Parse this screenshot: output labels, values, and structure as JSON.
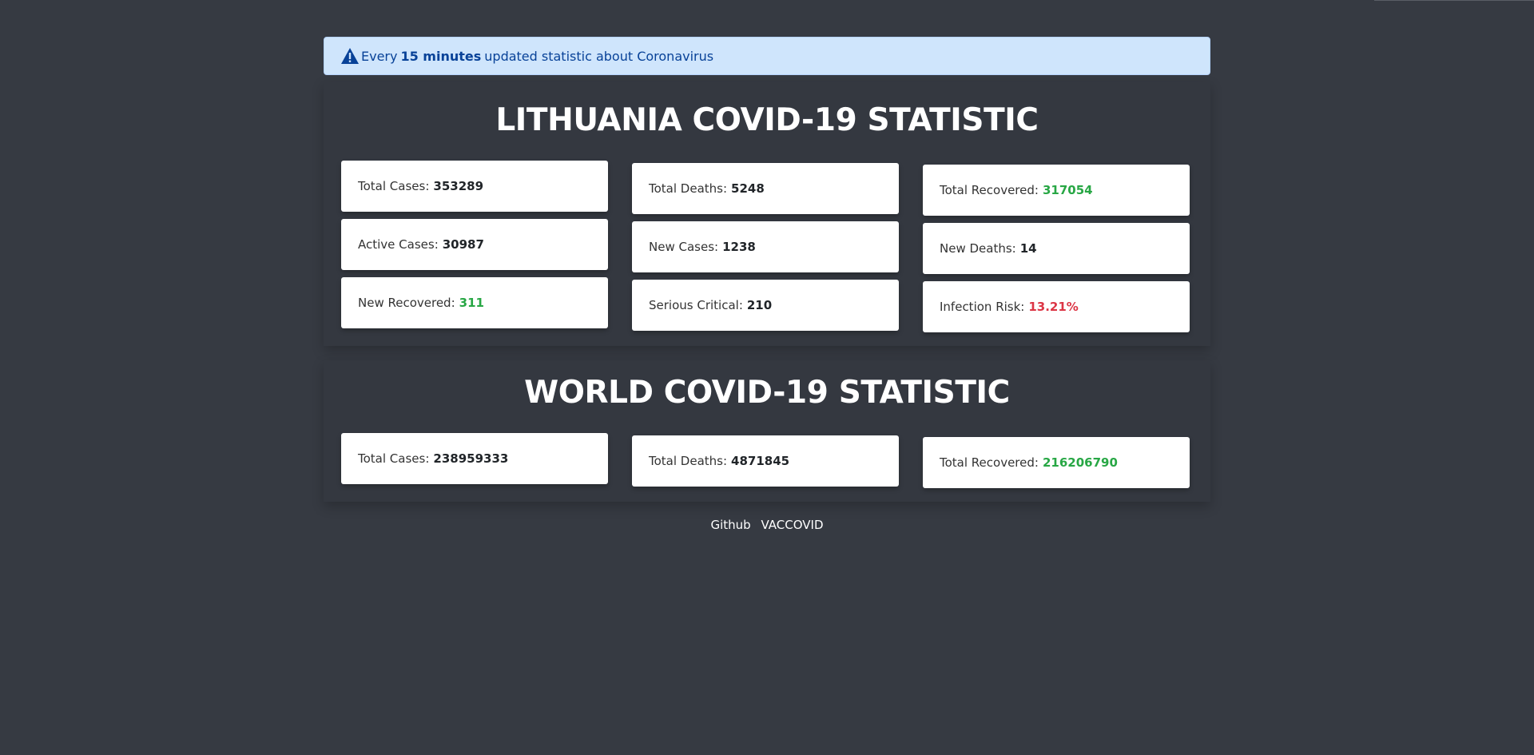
{
  "alert": {
    "prefix": "Every",
    "bold": "15 minutes",
    "suffix": "updated statistic about Coronavirus"
  },
  "lithuania": {
    "title": "LITHUANIA COVID-19 STATISTIC",
    "cards": [
      {
        "label": "Total Cases:",
        "value": "353289",
        "color": "default"
      },
      {
        "label": "Total Deaths:",
        "value": "5248",
        "color": "default"
      },
      {
        "label": "Total Recovered:",
        "value": "317054",
        "color": "green"
      },
      {
        "label": "Active Cases:",
        "value": "30987",
        "color": "default"
      },
      {
        "label": "New Cases:",
        "value": "1238",
        "color": "default"
      },
      {
        "label": "New Deaths:",
        "value": "14",
        "color": "default"
      },
      {
        "label": "New Recovered:",
        "value": "311",
        "color": "green"
      },
      {
        "label": "Serious Critical:",
        "value": "210",
        "color": "default"
      },
      {
        "label": "Infection Risk:",
        "value": "13.21%",
        "color": "red"
      }
    ]
  },
  "world": {
    "title": "WORLD COVID-19 STATISTIC",
    "cards": [
      {
        "label": "Total Cases:",
        "value": "238959333",
        "color": "default"
      },
      {
        "label": "Total Deaths:",
        "value": "4871845",
        "color": "default"
      },
      {
        "label": "Total Recovered:",
        "value": "216206790",
        "color": "green"
      }
    ]
  },
  "footer": {
    "links": [
      "Github",
      "VACCOVID"
    ]
  },
  "colors": {
    "background": "#363a42",
    "panel": "#343840",
    "alert_bg": "#cfe5fc",
    "alert_text": "#084298",
    "green": "#28a745",
    "red": "#dc3545"
  }
}
